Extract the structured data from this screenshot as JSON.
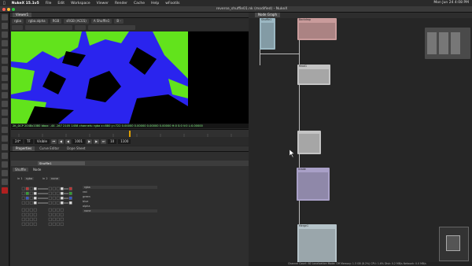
{
  "menubar": {
    "app": "NukeX 15.1v5",
    "items": [
      "File",
      "Edit",
      "Workspace",
      "Viewer",
      "Render",
      "Cache",
      "Help",
      "wFootils"
    ],
    "clock": "Mon Jun 24 4:08 PM"
  },
  "window": {
    "title": "reverse_shuffle01.nk (modified) - NukeX"
  },
  "viewer": {
    "tab_label": "Viewer1",
    "channels": "rgba",
    "layer": "rgba.alpha",
    "rgb_label": "RGB",
    "colorspace": "sRGB (ACES)",
    "input_a": "A  Shuffle1",
    "input_b": "B  -",
    "info_line": "2K_DCP 2048x1080  bbox: -44 -167 2105 1458 channels: rgba  x=880 y=722       0.00000  0.00000  0.00000  0.00000    H:0 S:0 V:0 L:0.00000"
  },
  "playback": {
    "fps_label": "24*",
    "mode": "TF",
    "range": "Visible",
    "frame": "1001",
    "end_frame": "1100",
    "step": "10"
  },
  "properties": {
    "tabs": [
      "Properties",
      "Curve Editor",
      "Dope Sheet"
    ],
    "node_name": "Shuffle1",
    "subtabs": [
      "Shuffle",
      "Node"
    ],
    "in1_label": "in 1",
    "in1_value": "rgba",
    "in2_label": "in 2",
    "in2_value": "none",
    "out1_value": "rgba",
    "out2_value": "none",
    "channel_rows": [
      "red",
      "green",
      "blue",
      "alpha"
    ]
  },
  "dag": {
    "tab_label": "Node Graph",
    "nodes": [
      {
        "label": "Shuffle1",
        "color": "#9bb7c2"
      },
      {
        "label": "Backdrop",
        "color": "#c99b9b"
      },
      {
        "label": "Read1",
        "color": "#c4c4c4"
      },
      {
        "label": "Grade",
        "color": "#a9a0c7"
      },
      {
        "label": "Merge1",
        "color": "#b5c3c9"
      }
    ],
    "status": "Channel Count: 80  Localization Mode: Off  Memory: 1.3 GB (8.2%)  CPU: 1.6%  Disk: 0.2 MB/s  Network: 0.0 MB/s"
  },
  "colors": {
    "viewer_blue": "#2a24ee",
    "viewer_green": "#62e31c",
    "red_slot": "#c23232",
    "green_slot": "#2fa02f",
    "blue_slot": "#3356c8"
  }
}
